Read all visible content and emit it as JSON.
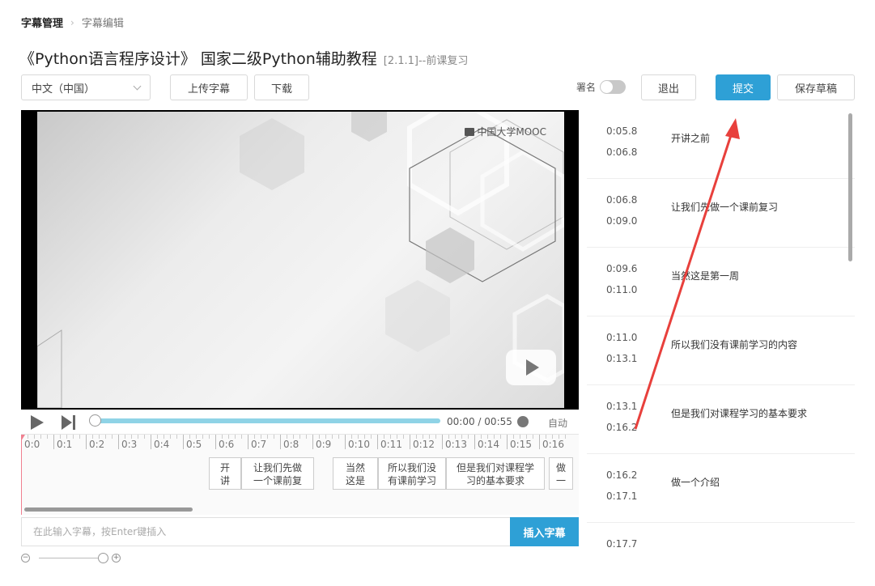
{
  "breadcrumb": {
    "root": "字幕管理",
    "current": "字幕编辑"
  },
  "title": {
    "main": "《Python语言程序设计》 国家二级Python辅助教程",
    "sub": "[2.1.1]--前课复习"
  },
  "toolbar": {
    "language_select": "中文（中国）",
    "upload_label": "上传字幕",
    "download_label": "下载",
    "sign_label": "署名",
    "exit_label": "退出",
    "submit_label": "提交",
    "save_draft_label": "保存草稿"
  },
  "video": {
    "watermark": "中国大学MOOC",
    "current_time": "00:00",
    "time_sep": "/",
    "duration": "00:55",
    "auto_label": "自动"
  },
  "timeline": {
    "ticks": [
      "0:0",
      "0:1",
      "0:2",
      "0:3",
      "0:4",
      "0:5",
      "0:6",
      "0:7",
      "0:8",
      "0:9",
      "0:10",
      "0:11",
      "0:12",
      "0:13",
      "0:14",
      "0:15",
      "0:16"
    ],
    "segments": [
      {
        "line1": "开",
        "line2": "讲"
      },
      {
        "line1": "让我们先做",
        "line2": "一个课前复"
      },
      {
        "line1": "当然",
        "line2": "这是"
      },
      {
        "line1": "所以我们没",
        "line2": "有课前学习"
      },
      {
        "line1": "但是我们对课程学",
        "line2": "习的基本要求"
      },
      {
        "line1": "做",
        "line2": "一"
      }
    ]
  },
  "input": {
    "placeholder": "在此输入字幕，按Enter键插入",
    "insert_label": "插入字幕"
  },
  "zoom": {
    "minus": "−",
    "plus": "+"
  },
  "subtitles": [
    {
      "start": "0:05.8",
      "end": "0:06.8",
      "text": "开讲之前"
    },
    {
      "start": "0:06.8",
      "end": "0:09.0",
      "text": "让我们先做一个课前复习"
    },
    {
      "start": "0:09.6",
      "end": "0:11.0",
      "text": "当然这是第一周"
    },
    {
      "start": "0:11.0",
      "end": "0:13.1",
      "text": "所以我们没有课前学习的内容"
    },
    {
      "start": "0:13.1",
      "end": "0:16.2",
      "text": "但是我们对课程学习的基本要求"
    },
    {
      "start": "0:16.2",
      "end": "0:17.1",
      "text": "做一个介绍"
    },
    {
      "start": "0:17.7",
      "end": "",
      "text": ""
    }
  ],
  "colors": {
    "primary": "#2ea0d6",
    "progress": "#8fd3e6",
    "annotation_arrow": "#e8403c",
    "playhead": "#f08090"
  }
}
